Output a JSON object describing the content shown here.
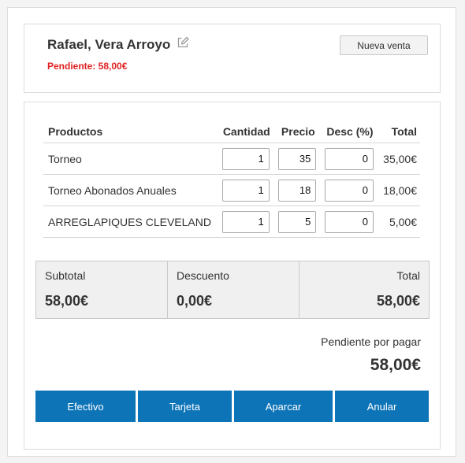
{
  "client": {
    "name": "Rafael, Vera Arroyo",
    "pending_label": "Pendiente: 58,00€",
    "new_sale_label": "Nueva venta"
  },
  "table": {
    "headers": {
      "product": "Productos",
      "quantity": "Cantidad",
      "price": "Precio",
      "discount": "Desc (%)",
      "total": "Total"
    },
    "rows": [
      {
        "product": "Torneo",
        "quantity": "1",
        "price": "35",
        "discount": "0",
        "total": "35,00€"
      },
      {
        "product": "Torneo Abonados Anuales",
        "quantity": "1",
        "price": "18",
        "discount": "0",
        "total": "18,00€"
      },
      {
        "product": "ARREGLAPIQUES CLEVELAND",
        "quantity": "1",
        "price": "5",
        "discount": "0",
        "total": "5,00€"
      }
    ]
  },
  "summary": {
    "subtotal_label": "Subtotal",
    "subtotal_value": "58,00€",
    "discount_label": "Descuento",
    "discount_value": "0,00€",
    "total_label": "Total",
    "total_value": "58,00€"
  },
  "pending": {
    "label": "Pendiente por pagar",
    "value": "58,00€"
  },
  "buttons": {
    "cash": "Efectivo",
    "card": "Tarjeta",
    "park": "Aparcar",
    "cancel": "Anular"
  },
  "colors": {
    "accent": "#0e74b8",
    "pending_red": "#e02020"
  },
  "icons": {
    "edit": "edit-icon"
  }
}
